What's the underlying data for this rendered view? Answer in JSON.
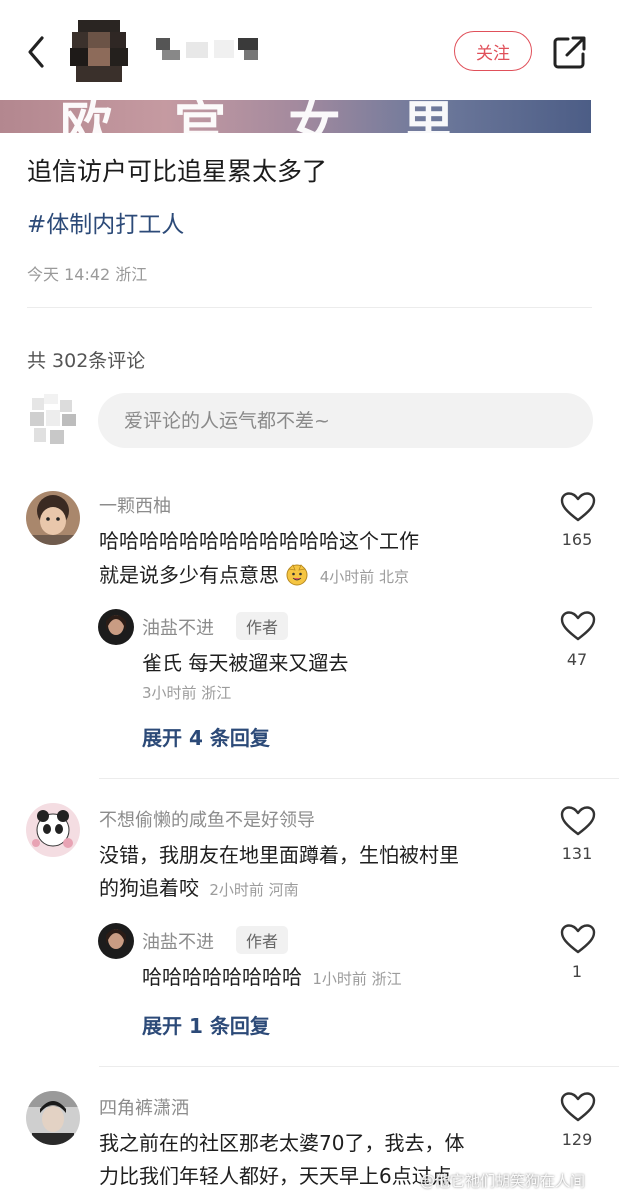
{
  "header": {
    "back_icon": "chevron-left-icon",
    "follow_label": "关注",
    "share_icon": "share-out-icon",
    "accent_color": "#e0505a"
  },
  "media": {
    "partial_text": "欧 官 女 里"
  },
  "post": {
    "title": "追信访户可比追星累太多了",
    "hashtag": "#体制内打工人",
    "meta": "今天 14:42 浙江"
  },
  "comments_section": {
    "count_text": "共 302条评论",
    "input_placeholder": "爱评论的人运气都不差~"
  },
  "comments": [
    {
      "name": "一颗西柚",
      "line1": "哈哈哈哈哈哈哈哈哈哈哈哈这个工作",
      "line2": "就是说多少有点意思",
      "meta": "4小时前 北京",
      "likes": "165",
      "reply": {
        "name": "油盐不进",
        "tag": "作者",
        "text": "雀氏 每天被遛来又遛去",
        "meta": "3小时前 浙江",
        "likes": "47"
      },
      "expand": "展开 4 条回复"
    },
    {
      "name": "不想偷懒的咸鱼不是好领导",
      "line1": "没错，我朋友在地里面蹲着，生怕被村里",
      "line2": "的狗追着咬",
      "meta": "2小时前 河南",
      "likes": "131",
      "reply": {
        "name": "油盐不进",
        "tag": "作者",
        "text": "哈哈哈哈哈哈哈哈",
        "meta": "1小时前 浙江",
        "likes": "1"
      },
      "expand": "展开 1 条回复"
    },
    {
      "name": "四角裤潇洒",
      "line1": "我之前在的社区那老太婆70了，我去，体",
      "line2": "力比我们年轻人都好，天天早上6点过点",
      "likes": "129"
    }
  ],
  "watermark": "@他它祂们胡笑狗在人间"
}
